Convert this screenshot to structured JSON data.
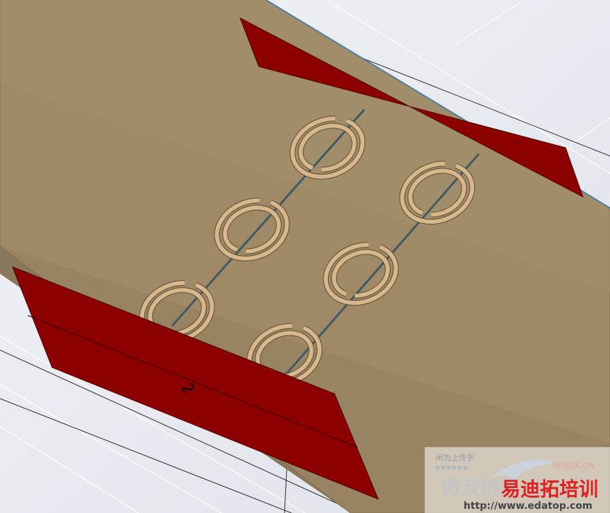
{
  "colors": {
    "background": "#e9ebf1",
    "substrate": "#9f8967",
    "substrate_edge": "#7f6c4f",
    "port": "#8c0000",
    "port_edge": "#4a0000",
    "resonator": "#d7b78c",
    "resonator_edge": "#5b4a33",
    "microstrip": "#3e5a66",
    "grid_line": "#ffffff",
    "wire": "#1a1a1a"
  },
  "port": {
    "label": "2"
  },
  "resonators": {
    "count": 6
  },
  "watermark": {
    "small_text": "闲为上传于",
    "brand_cn": "微波仿真",
    "brand_en": "RFEDA.CN",
    "logo_cn": "易迪拓培训",
    "url": "http://www.edatop.com"
  }
}
